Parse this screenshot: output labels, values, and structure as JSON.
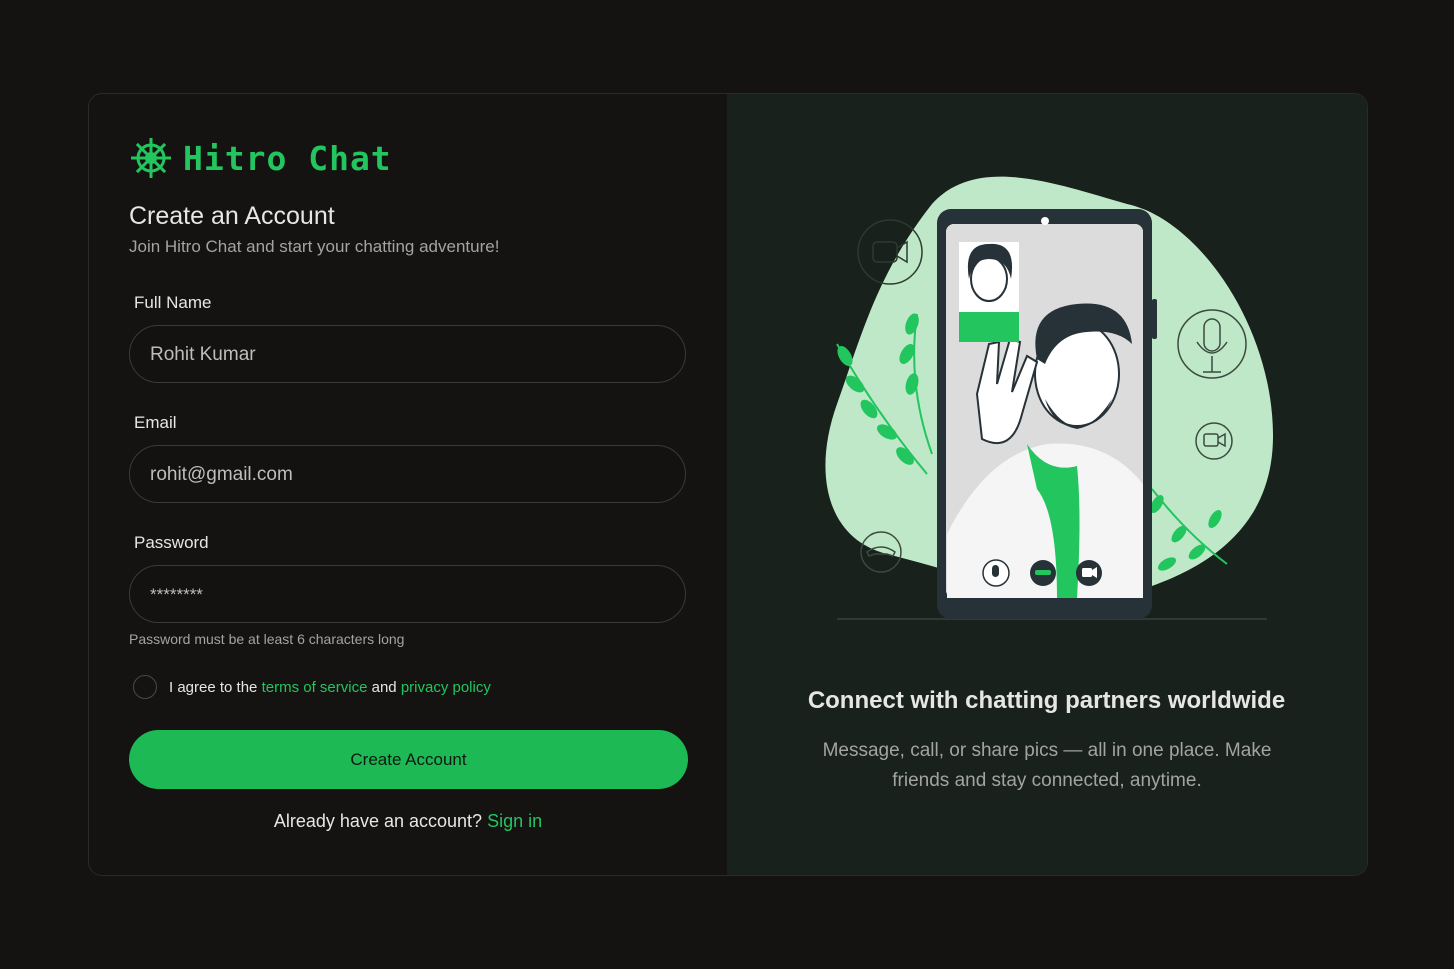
{
  "brand": {
    "name": "Hitro Chat",
    "accent_color": "#22c55e",
    "logo_icon": "ship-wheel-icon"
  },
  "form": {
    "title": "Create an Account",
    "subtitle": "Join Hitro Chat and start your chatting adventure!",
    "full_name": {
      "label": "Full Name",
      "value": "Rohit Kumar"
    },
    "email": {
      "label": "Email",
      "value": "rohit@gmail.com"
    },
    "password": {
      "label": "Password",
      "value": "********"
    },
    "password_hint": "Password must be at least 6 characters long",
    "agree": {
      "prefix": "I agree to the",
      "terms_link": "terms of service",
      "conjunction": "and",
      "privacy_link": "privacy policy",
      "checked": false
    },
    "submit_label": "Create Account",
    "signin_prompt": "Already have an account?",
    "signin_link": "Sign in"
  },
  "promo": {
    "heading": "Connect with chatting partners worldwide",
    "description": "Message, call, or share pics — all in one place. Make friends and stay connected, anytime.",
    "illustration": "video-call-illustration"
  }
}
